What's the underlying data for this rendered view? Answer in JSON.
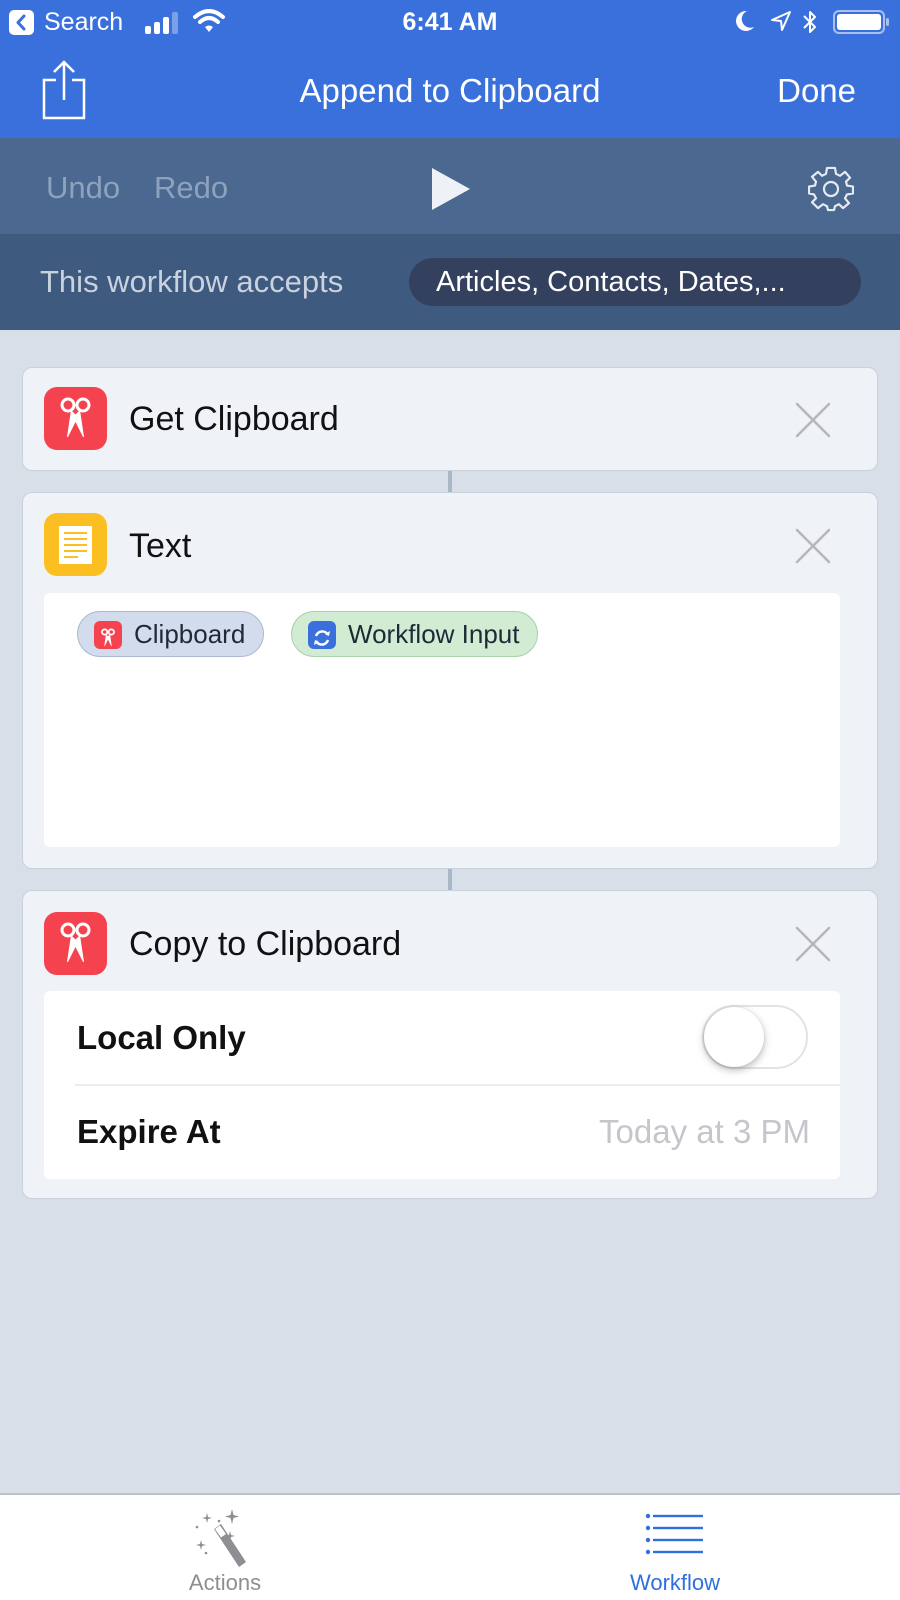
{
  "status_bar": {
    "back_app": "Search",
    "time": "6:41 AM",
    "icons": [
      "back-arrow-icon",
      "signal-icon",
      "wifi-icon",
      "moon-icon",
      "location-icon",
      "bluetooth-icon",
      "battery-icon"
    ]
  },
  "nav": {
    "title": "Append to Clipboard",
    "done_label": "Done",
    "share_icon": "share-icon"
  },
  "toolbar": {
    "undo_label": "Undo",
    "redo_label": "Redo",
    "play_icon": "play-icon",
    "settings_icon": "gear-icon"
  },
  "accepts": {
    "label": "This workflow accepts",
    "value": "Articles, Contacts, Dates,..."
  },
  "actions": [
    {
      "title": "Get Clipboard",
      "icon": "scissors-icon",
      "icon_color": "#f4424f"
    },
    {
      "title": "Text",
      "icon": "document-icon",
      "icon_color": "#fbbf22",
      "tokens": [
        {
          "label": "Clipboard",
          "icon": "scissors-icon",
          "color": "#d3dcec"
        },
        {
          "label": "Workflow Input",
          "icon": "refresh-icon",
          "color": "#d2ecd4"
        }
      ]
    },
    {
      "title": "Copy to Clipboard",
      "icon": "scissors-icon",
      "icon_color": "#f4424f",
      "params": [
        {
          "label": "Local Only",
          "type": "toggle",
          "value": false
        },
        {
          "label": "Expire At",
          "type": "value",
          "value": "Today at 3 PM"
        }
      ]
    }
  ],
  "tabbar": {
    "tabs": [
      {
        "label": "Actions",
        "icon": "magic-wand-icon",
        "active": false
      },
      {
        "label": "Workflow",
        "icon": "list-icon",
        "active": true
      }
    ]
  },
  "colors": {
    "accent": "#3a70dc",
    "toolbar": "#4a6890",
    "accepts_bar": "#3f5a7f",
    "canvas": "#d9dfe8",
    "active_tab": "#2f6fe0"
  }
}
